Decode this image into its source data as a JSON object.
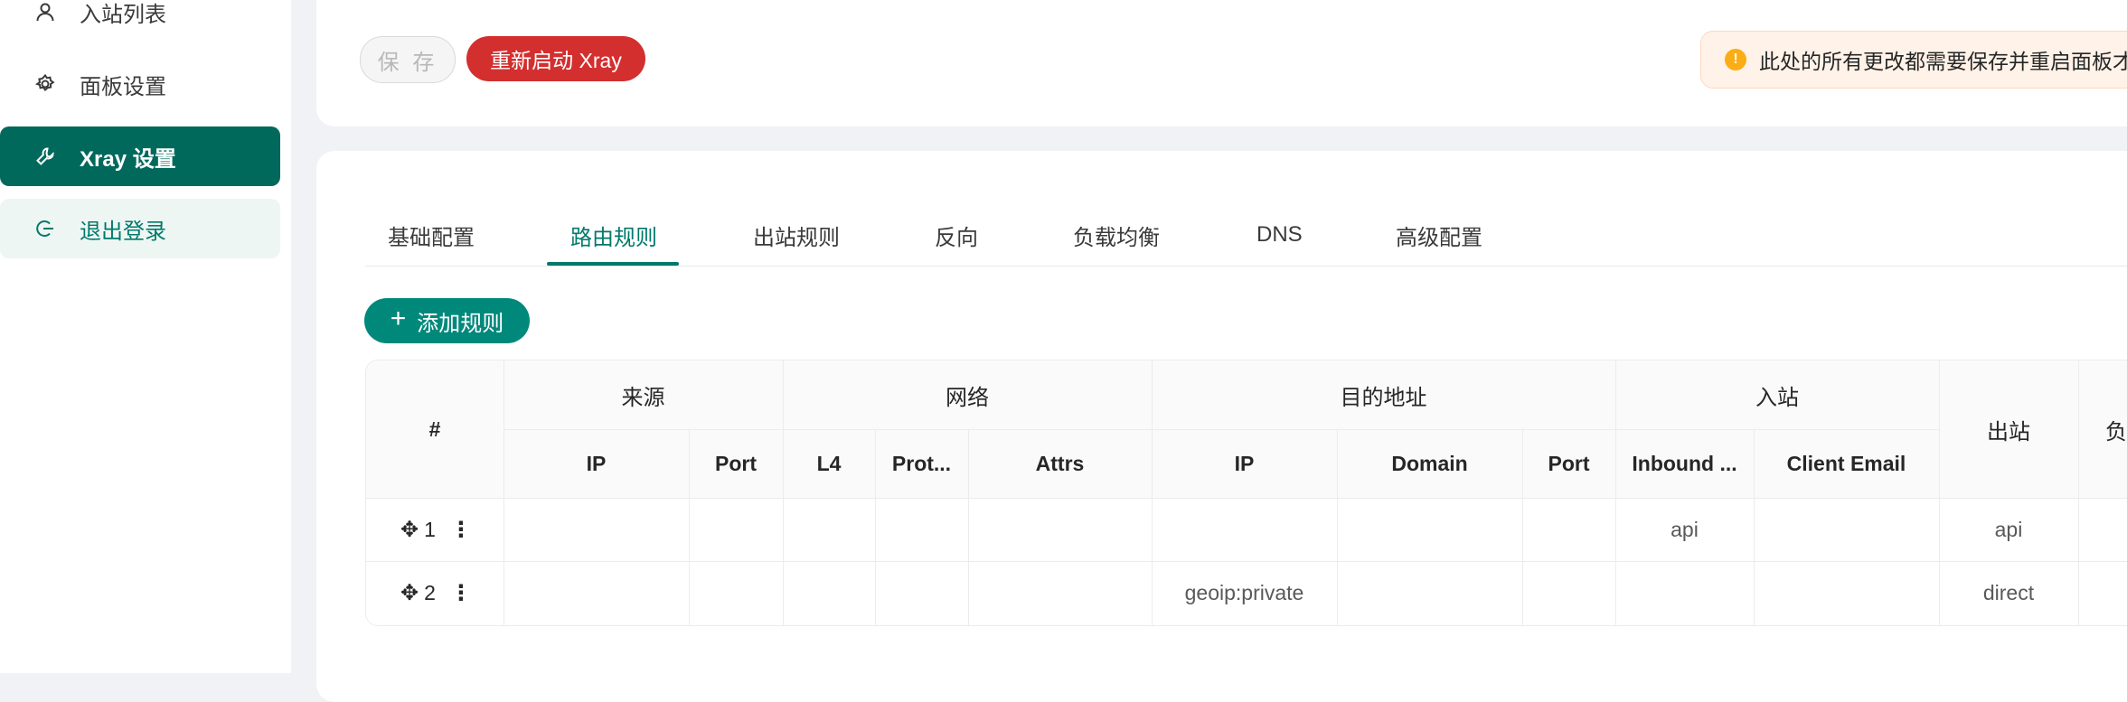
{
  "sidebar": {
    "items": [
      {
        "label": "入站列表",
        "icon": "user-icon"
      },
      {
        "label": "面板设置",
        "icon": "gear-icon"
      },
      {
        "label": "Xray 设置",
        "icon": "wrench-icon"
      },
      {
        "label": "退出登录",
        "icon": "logout-icon"
      }
    ]
  },
  "toolbar": {
    "save_label": "保 存",
    "restart_label": "重新启动 Xray",
    "alert_text": "此处的所有更改都需要保存并重启面板才能生效"
  },
  "tabs": [
    "基础配置",
    "路由规则",
    "出站规则",
    "反向",
    "负载均衡",
    "DNS",
    "高级配置"
  ],
  "active_tab": "路由规则",
  "add_rule_label": "添加规则",
  "table": {
    "group_headers": {
      "index": "#",
      "source": "来源",
      "network": "网络",
      "destination": "目的地址",
      "inbound": "入站",
      "outbound": "出站",
      "balancer": "负"
    },
    "sub_headers": {
      "source_ip": "IP",
      "source_port": "Port",
      "l4": "L4",
      "protocol": "Prot...",
      "attrs": "Attrs",
      "dest_ip": "IP",
      "dest_domain": "Domain",
      "dest_port": "Port",
      "inbound_tag": "Inbound ...",
      "client_email": "Client Email"
    },
    "rows": [
      {
        "index": "1",
        "source_ip": "",
        "source_port": "",
        "l4": "",
        "protocol": "",
        "attrs": "",
        "dest_ip": "",
        "dest_domain": "",
        "dest_port": "",
        "inbound_tag": "api",
        "client_email": "",
        "outbound": "api"
      },
      {
        "index": "2",
        "source_ip": "",
        "source_port": "",
        "l4": "",
        "protocol": "",
        "attrs": "",
        "dest_ip": "geoip:private",
        "dest_domain": "",
        "dest_port": "",
        "inbound_tag": "",
        "client_email": "",
        "outbound": "direct"
      }
    ]
  }
}
